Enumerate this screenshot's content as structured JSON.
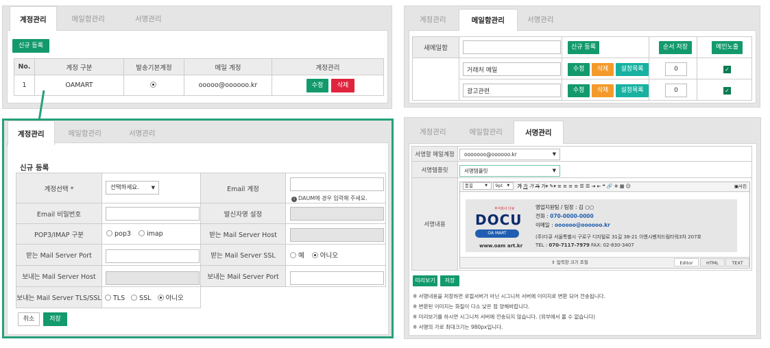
{
  "tabs": {
    "accounts": "계정관리",
    "mailbox": "메일함관리",
    "signature": "서명관리"
  },
  "account_list": {
    "new_button": "신규 등록",
    "columns": [
      "No.",
      "계정 구분",
      "발송기본계정",
      "메일 계정",
      "계정관리"
    ],
    "rows": [
      {
        "no": "1",
        "type": "OAMART",
        "email": "ooooo@oooooo.kr",
        "edit": "수정",
        "delete": "삭제"
      }
    ]
  },
  "register": {
    "section_title": "신규 등록",
    "account_select_label": "계정선택 *",
    "account_select_value": "선택하세요.",
    "email_account_label": "Email 계정",
    "daum_hint": "DAUM에 경우 입력해 주세요.",
    "email_password_label": "Email 비밀번호",
    "sender_name_label": "발신자명 설정",
    "protocol_label": "POP3/IMAP 구분",
    "protocol_pop3": "pop3",
    "protocol_imap": "imap",
    "recv_host_label": "받는 Mail Server Host",
    "recv_port_label": "받는 Mail Server Port",
    "recv_ssl_label": "받는 Mail Server SSL",
    "yes": "예",
    "no": "아니오",
    "send_host_label": "보내는 Mail Server Host",
    "send_port_label": "보내는 Mail Server Port",
    "send_tls_label": "보내는 Mail Server TLS/SSL",
    "tls": "TLS",
    "ssl": "SSL",
    "cancel": "취소",
    "save": "저장"
  },
  "mailbox": {
    "new_mailbox_label": "새메일함",
    "new_button": "신규 등록",
    "order_save": "순서 저장",
    "main_expose": "메인노출",
    "rows": [
      {
        "name": "거래처 메일",
        "edit": "수정",
        "delete": "삭제",
        "settings": "설정목록",
        "order": "0"
      },
      {
        "name": "광고관련",
        "edit": "수정",
        "delete": "삭제",
        "settings": "설정목록",
        "order": "0"
      }
    ]
  },
  "signature": {
    "mail_account_label": "서명할 메일계정",
    "mail_account_value": "ooooooo@oooooo.kr",
    "template_label": "서명템플릿",
    "template_value": "서명템플릿",
    "content_label": "서명내용",
    "toolbar": {
      "font": "돋움",
      "size": "9pt",
      "source": "사진"
    },
    "card": {
      "logo_small": "주식회사 다큐",
      "logo": "DOCU",
      "oamart": "OA MART",
      "website": "www.oam art.kr",
      "team_label": "영업지원팀 / 팀장 :",
      "team_value": "김 ○○",
      "phone_label": "전화 :",
      "phone_value": "070-0000-0000",
      "email_label": "이메일 :",
      "email_value": "oooooo@oooooo.kr",
      "address": "(주)다큐 서울특별시 구로구 디지털로 31길 38-21 이엔시벤처드림타워3차 207호",
      "tel_label": "TEL :",
      "tel_value": "070-7117-7979",
      "fax": "FAX: 02-830-3407"
    },
    "resize_hint": "⇕ 입력창 크기 조절",
    "editor_tabs": [
      "Editor",
      "HTML",
      "TEXT"
    ],
    "preview": "미리보기",
    "save": "저장",
    "notes": [
      "※ 서명내용을 저장하면 로컬서버가 아닌 시그니처 서버에 이미지로 변환 되어 전송됩니다.",
      "※ 변환된 이미지는 화질이 다소 낮은 점 양해바랍니다.",
      "※ 미리보기를 하시면 시그니처 서버에 전송되지 않습니다. (외부에서 볼 수 없습니다)",
      "※ 서명의 가로 최대크기는 980px입니다."
    ]
  },
  "colors": {
    "accent": "#139a6c",
    "delete": "#e0243d",
    "orange": "#f39a2a",
    "teal": "#17b1a1"
  }
}
